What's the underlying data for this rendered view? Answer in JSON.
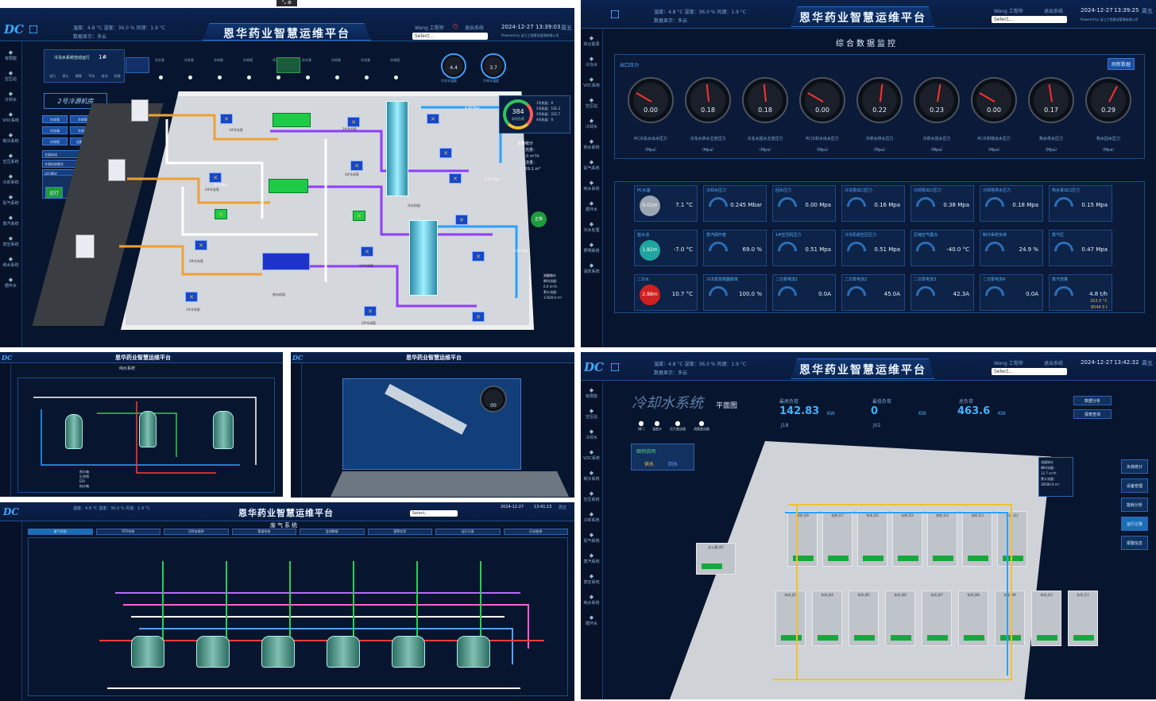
{
  "top_icons": "⤡ ⚙",
  "app": {
    "logo": "DC",
    "title": "恩华药业智慧运维平台",
    "weather": "温度：4.8 °C    湿度：36.0 %    风速：1.9 °C",
    "weather_sub": "数据显示：多云",
    "user": "Wang 工程师",
    "logout": "退出系统",
    "select_placeholder": "Select...",
    "powered": "Powered by 浙江工程建设管理有限公司"
  },
  "nav": {
    "items": [
      "有限能",
      "空压站",
      "冷却水",
      "VOC系统",
      "制冷系统",
      "空压系统",
      "冷却系统",
      "氮气系统",
      "蒸汽系统",
      "真空系统",
      "纯水系统",
      "循环水"
    ]
  },
  "p1": {
    "date": "2024-12-27",
    "time": "13:39:03",
    "weekday": "周五",
    "cmd_title": "冷冻水系统自动运行",
    "cmd_val": "1#",
    "cmd_labels": [
      "运行",
      "停止",
      "故障",
      "手动",
      "自动",
      "检修"
    ],
    "top_labels": [
      "冷水泵",
      "冷冻泵",
      "冷却泵",
      "冷却塔",
      "冷冻机",
      "冷水泵",
      "冷却泵",
      "冷冻泵",
      "冷却塔"
    ],
    "room_title": "2号冷源机房",
    "panel_btns": [
      "冷冻泵",
      "冷却泵",
      "冷冻阀",
      "冷却阀",
      "冷却塔",
      "设备启动",
      "全部启动",
      "冷源机房模式",
      "运行模式"
    ],
    "run_label": "运行",
    "stop_label": "停止",
    "g1": "4.4",
    "g2": "3.7",
    "g1_label": "冷冻水温度",
    "g2_label": "冷却水温度",
    "ring_val": "384",
    "ring_label": "实时负荷",
    "ring_legend": [
      "1号机组：0",
      "2号机组：161.3",
      "3号机组：222.7",
      "4号机组：0"
    ],
    "flow_title": "流量统计",
    "flow_lines": [
      "瞬时流量：",
      "103.0 m³/h",
      "累计流量：",
      "59759.1 m³"
    ],
    "flow2_title": "流量统计",
    "flow2_lines": [
      "瞬时流量：",
      "0.0 m³/h",
      "累计流量：",
      "17829.0 m³"
    ],
    "equip_labels": [
      "1#冷冻泵",
      "2#冷冻泵",
      "3#冷冻泵",
      "1#冷却泵",
      "2#冷却泵",
      "3#冷却泵",
      "1#冷却塔",
      "2#冷却塔",
      "冷水机组",
      "热水机组"
    ],
    "status_badge": "正常",
    "pressures": [
      "4.06 Mpa",
      "0.17 Mpa",
      "0.00 Mpa",
      "6.0 Mpa"
    ]
  },
  "p2": {
    "date": "2024-12-27",
    "time": "13:39:25",
    "weekday": "周五",
    "section": "综合数据监控",
    "subsection": "出口压力",
    "refresh_btn": "刷新数据",
    "gauges": [
      {
        "val": "0.00",
        "label": "PC冷冻水出水压力",
        "unit": "（Mpa）"
      },
      {
        "val": "0.18",
        "label": "冷冻水供水主管压力",
        "unit": "（Mpa）"
      },
      {
        "val": "0.18",
        "label": "冷冻水回水主管压力",
        "unit": "（Mpa）"
      },
      {
        "val": "0.00",
        "label": "PC冷却水出水压力",
        "unit": "（Mpa）"
      },
      {
        "val": "0.22",
        "label": "冷却水供水压力",
        "unit": "（Mpa）"
      },
      {
        "val": "0.23",
        "label": "冷却水回水压力",
        "unit": "（Mpa）"
      },
      {
        "val": "0.00",
        "label": "PC冷却塔出水压力",
        "unit": "（Mpa）"
      },
      {
        "val": "0.17",
        "label": "热水供水压力",
        "unit": "（Mpa）"
      },
      {
        "val": "0.29",
        "label": "热水回水压力",
        "unit": "（Mpa）"
      }
    ],
    "cards": [
      {
        "t": "PC水温",
        "v": "7.1 °C",
        "c": "0.01m",
        "cc": "#9aa6b2"
      },
      {
        "t": "冷却水压力",
        "v": "0.245 Mbar"
      },
      {
        "t": "回水压力",
        "v": "0.00 Mpa"
      },
      {
        "t": "冷冻泵出口压力",
        "v": "0.16 Mpa"
      },
      {
        "t": "冷却泵出口压力",
        "v": "0.38 Mpa"
      },
      {
        "t": "冷却塔供水压力",
        "v": "0.18 Mpa"
      },
      {
        "t": "热水泵出口压力",
        "v": "0.15 Mpa"
      },
      {
        "t": "盐水池",
        "v": "-7.0 °C",
        "c": "1.82m",
        "cc": "#1fa5a0"
      },
      {
        "t": "蒸汽阀开度",
        "v": "69.0 %"
      },
      {
        "t": "1#空压机压力",
        "v": "0.51 Mpa"
      },
      {
        "t": "冷冻机组空压压力",
        "v": "0.51 Mpa"
      },
      {
        "t": "压缩空气露点",
        "v": "-40.0 °C"
      },
      {
        "t": "制冷系统负荷",
        "v": "24.9 %"
      },
      {
        "t": "蒸汽压",
        "v": "0.47 Mpa"
      },
      {
        "t": "二次水",
        "v": "10.7 °C",
        "c": "2.88m",
        "cc": "#d02020"
      },
      {
        "t": "冷冻泵变频器频率",
        "v": "100.0 %"
      },
      {
        "t": "二次泵电流1",
        "v": "0.0A"
      },
      {
        "t": "二次泵电流2",
        "v": "45.0A"
      },
      {
        "t": "二次泵电流3",
        "v": "42.3A"
      },
      {
        "t": "二次泵电流4",
        "v": "0.0A"
      },
      {
        "t": "蒸汽流量",
        "v": "4.8 t/h"
      }
    ],
    "steam_extra": [
      "202.0 °C",
      "8544.5 t"
    ],
    "left_nav": [
      "综合能源",
      "冷冻水",
      "VOC系统",
      "空压站",
      "冷却水",
      "热水系统",
      "氮气系统",
      "纯水系统",
      "循环水",
      "污水处理",
      "照明系统",
      "消防系统"
    ]
  },
  "p3": {
    "title": "恩华药业智慧运维平台",
    "sub": "纯水系统",
    "legend": [
      "原水箱",
      "反渗透",
      "EDI",
      "纯水箱"
    ]
  },
  "p4": {
    "title": "恩华药业智慧运维平台",
    "center": "00"
  },
  "p5": {
    "title": "恩华药业智慧运维平台",
    "sub": "废气系统",
    "date": "2024-12-27",
    "time": "13:41:13",
    "weekday": "周五",
    "tabs": [
      "废气系统",
      "RTO系统",
      "活性炭吸附",
      "管道系统",
      "监测数据",
      "报警信息",
      "运行记录",
      "历史曲线"
    ]
  },
  "p6": {
    "date": "2024-12-27",
    "time": "13:42:32",
    "weekday": "周五",
    "sys_title": "冷却水系统",
    "plan": "平面图",
    "stat1_label": "最高负荷",
    "stat1": "142.83",
    "stat1_unit": "KW",
    "stat1_sub": "J18",
    "stat2_label": "最低负荷",
    "stat2": "0",
    "stat2_unit": "KW",
    "stat2_sub": "J02",
    "stat3_label": "总负荷",
    "stat3": "463.6",
    "stat3_unit": "KW",
    "legend_title": "图例说明",
    "legend": [
      "供水",
      "回水"
    ],
    "icons": [
      "阀门",
      "温度计",
      "压力变送器",
      "流量变送器"
    ],
    "right_btns": [
      "数据分析",
      "报表查询",
      "负荷统计",
      "设备管理",
      "能耗分析",
      "运行记录",
      "报警信息"
    ],
    "flow_box": [
      "流量统计",
      "瞬时流量：",
      "12.7 m³/h",
      "累计流量：",
      "38580.9 m³"
    ],
    "rooms": [
      "冷库 J18",
      "仓库 J17",
      "车间 J16",
      "仓库 J15",
      "库房 J14",
      "仓库 J13",
      "车间 J12",
      "办公楼 J02",
      "车间 J03",
      "车间 J04",
      "车间 J05",
      "车间 J06",
      "车间 J07",
      "车间 J08",
      "车间 J09",
      "车间 J10",
      "车间 J11"
    ]
  }
}
